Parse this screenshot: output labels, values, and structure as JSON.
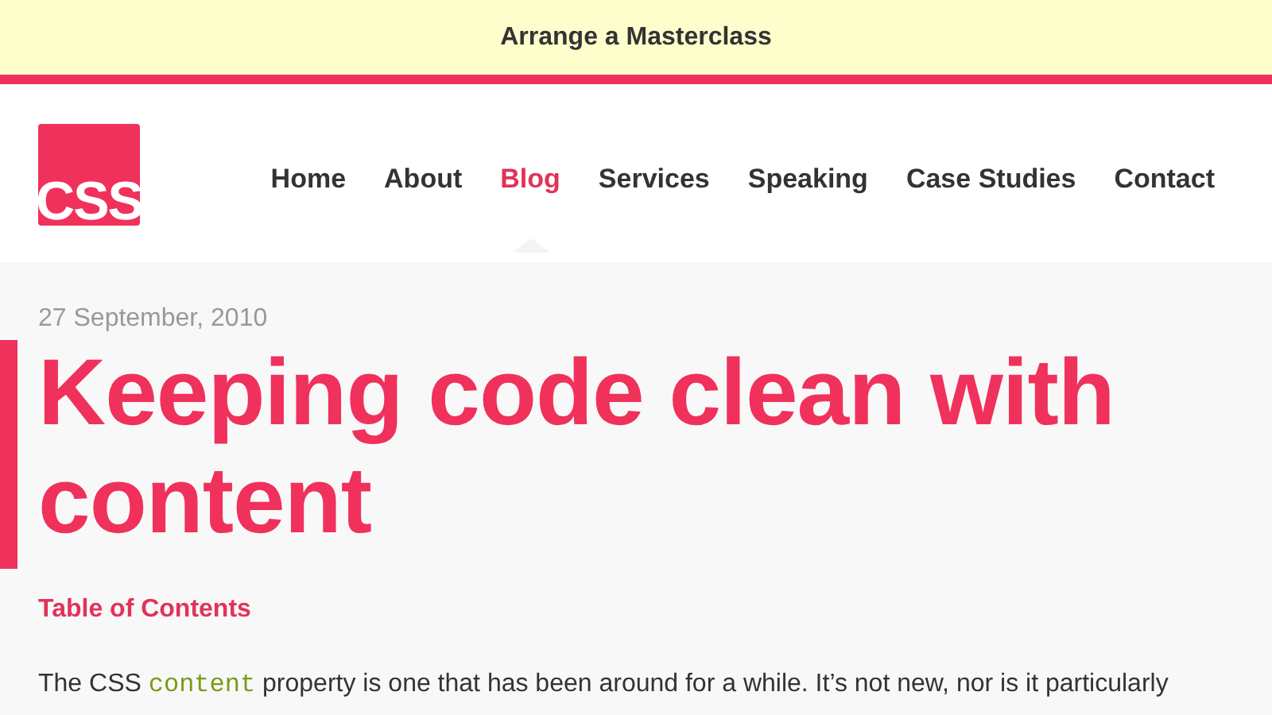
{
  "banner": {
    "link": "Arrange a Masterclass"
  },
  "header": {
    "logo": "CSS",
    "nav": [
      {
        "label": "Home",
        "selected": false
      },
      {
        "label": "About",
        "selected": false
      },
      {
        "label": "Blog",
        "selected": true
      },
      {
        "label": "Services",
        "selected": false
      },
      {
        "label": "Speaking",
        "selected": false
      },
      {
        "label": "Case Studies",
        "selected": false
      },
      {
        "label": "Contact",
        "selected": false
      }
    ]
  },
  "article": {
    "date": "27 September, 2010",
    "title": "Keeping code clean with content",
    "toc_link": "Table of Contents",
    "paragraph": [
      {
        "kind": "text",
        "text": "The CSS "
      },
      {
        "kind": "code",
        "text": "content"
      },
      {
        "kind": "text",
        "text": " property is one that has been around for a while. It’s not new, nor is it particularly"
      }
    ]
  }
}
